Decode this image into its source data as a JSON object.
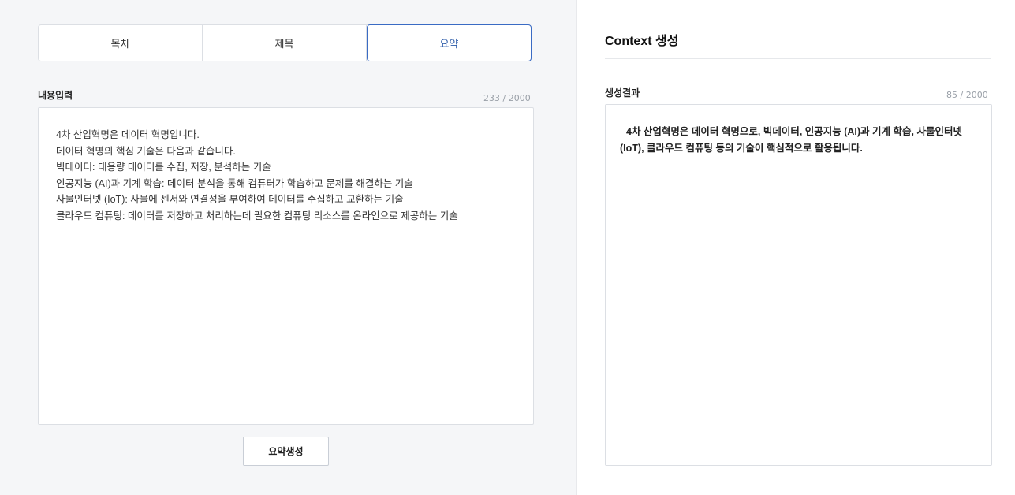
{
  "tabs": [
    {
      "label": "목차",
      "active": false
    },
    {
      "label": "제목",
      "active": false
    },
    {
      "label": "요약",
      "active": true
    }
  ],
  "input": {
    "label": "내용입력",
    "counter": "233 / 2000",
    "lines": [
      "4차 산업혁명은 데이터 혁명입니다.",
      "데이터 혁명의 핵심 기술은 다음과 같습니다.",
      "빅데이터: 대용량 데이터를 수집, 저장, 분석하는 기술",
      "인공지능 (AI)과 기계 학습: 데이터 분석을 통해 컴퓨터가 학습하고 문제를 해결하는 기술",
      "사물인터넷 (IoT): 사물에 센서와 연결성을 부여하여 데이터를 수집하고 교환하는 기술",
      "클라우드 컴퓨팅: 데이터를 저장하고 처리하는데 필요한 컴퓨팅 리소스를 온라인으로 제공하는 기술"
    ]
  },
  "generate_button": {
    "label": "요약생성"
  },
  "context": {
    "title": "Context 생성",
    "result_label": "생성결과",
    "counter": "85 / 2000",
    "result_text": "4차 산업혁명은 데이터 혁명으로, 빅데이터, 인공지능 (AI)과 기계 학습, 사물인터넷 (IoT), 클라우드 컴퓨팅 등의 기술이 핵심적으로 활용됩니다."
  },
  "colors": {
    "accent": "#3a6bc4",
    "panel_bg": "#f5f6f8",
    "border": "#dcdfe4"
  }
}
